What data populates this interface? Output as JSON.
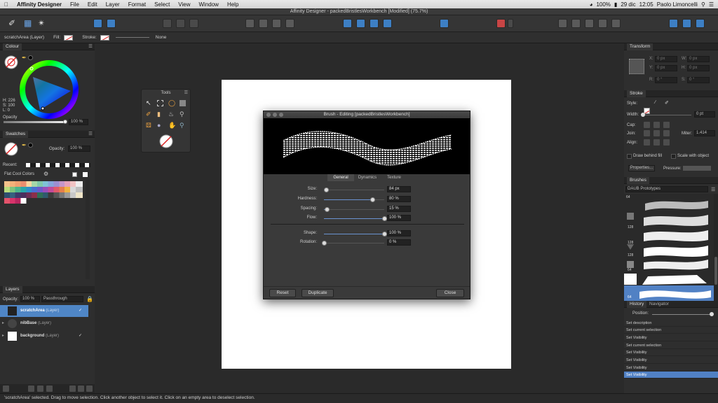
{
  "menubar": {
    "app": "Affinity Designer",
    "items": [
      "File",
      "Edit",
      "Layer",
      "Format",
      "Select",
      "View",
      "Window",
      "Help"
    ],
    "battery": "100%",
    "date": "29 dic",
    "time": "12:05",
    "user": "Paolo Limoncelli"
  },
  "window": {
    "title": "Affinity Designer - packedBristlesWorkbench [Modified] (75.7%)"
  },
  "context": {
    "layer": "scratchArea (Layer)",
    "fill_label": "Fill:",
    "stroke_label": "Stroke:",
    "stroke_value": "None"
  },
  "colour": {
    "title": "Colour",
    "h": "H: 226",
    "s": "S: 100",
    "l": "L: 0",
    "opacity_label": "Opacity",
    "opacity_value": "100 %"
  },
  "swatches": {
    "title": "Swatches",
    "opacity_label": "Opacity:",
    "opacity_value": "100 %",
    "recent_label": "Recent:",
    "palette": "Flat Cool Colors"
  },
  "layers": {
    "title": "Layers",
    "opacity_label": "Opacity:",
    "opacity_value": "100 %",
    "blend": "Passthrough",
    "rows": [
      {
        "name": "scratchArea",
        "type": "(Layer)"
      },
      {
        "name": "nibBase",
        "type": "(Layer)"
      },
      {
        "name": "background",
        "type": "(Layer)"
      }
    ]
  },
  "tools": {
    "title": "Tools"
  },
  "brush_dialog": {
    "title": "Brush - Editing [packedBristlesWorkbench]",
    "tabs": [
      "General",
      "Dynamics",
      "Texture"
    ],
    "params": [
      {
        "name": "Size:",
        "value": "84 px",
        "level": 0.04
      },
      {
        "name": "Hardness:",
        "value": "80 %",
        "level": 0.8
      },
      {
        "name": "Spacing:",
        "value": "15 %",
        "level": 0.05
      },
      {
        "name": "Flow:",
        "value": "100 %",
        "level": 1.0
      },
      {
        "name": "Shape:",
        "value": "100 %",
        "level": 1.0
      },
      {
        "name": "Rotation:",
        "value": "0 %",
        "level": 0.0
      }
    ],
    "buttons": {
      "reset": "Reset",
      "duplicate": "Duplicate",
      "close": "Close"
    }
  },
  "transform": {
    "title": "Transform",
    "x_label": "X:",
    "y_label": "Y:",
    "w_label": "W:",
    "h_label": "H:",
    "r_label": "R:",
    "s_label": "S:",
    "x": "0 px",
    "y": "0 px",
    "w": "0 px",
    "h": "0 px",
    "r": "0 °",
    "s": "0 °"
  },
  "stroke": {
    "title": "Stroke",
    "style_label": "Style:",
    "width_label": "Width:",
    "width_value": "0 pt",
    "cap_label": "Cap:",
    "join_label": "Join:",
    "miter_label": "Miter:",
    "miter_value": "1.414",
    "align_label": "Align:",
    "draw_behind": "Draw behind fill",
    "scale_with": "Scale with object",
    "properties": "Properties...",
    "pressure": "Pressure:"
  },
  "brushes": {
    "title": "Brushes",
    "category": "DAUB Prototypes",
    "sizes": [
      "64",
      "128",
      "128",
      "128",
      "64",
      "64"
    ]
  },
  "history": {
    "tabs": [
      "History",
      "Navigator"
    ],
    "position_label": "Position:",
    "items": [
      "Set description",
      "Set current selection",
      "Set Visibility",
      "Set current selection",
      "Set Visibility",
      "Set Visibility",
      "Set Visibility",
      "Set Visibility"
    ]
  },
  "status": {
    "text": "'scratchArea' selected. Drag to move selection. Click another object to select it. Click on an empty area to deselect selection."
  },
  "colors": {
    "accent": "#3d7fc4",
    "selection": "#5181c4"
  }
}
